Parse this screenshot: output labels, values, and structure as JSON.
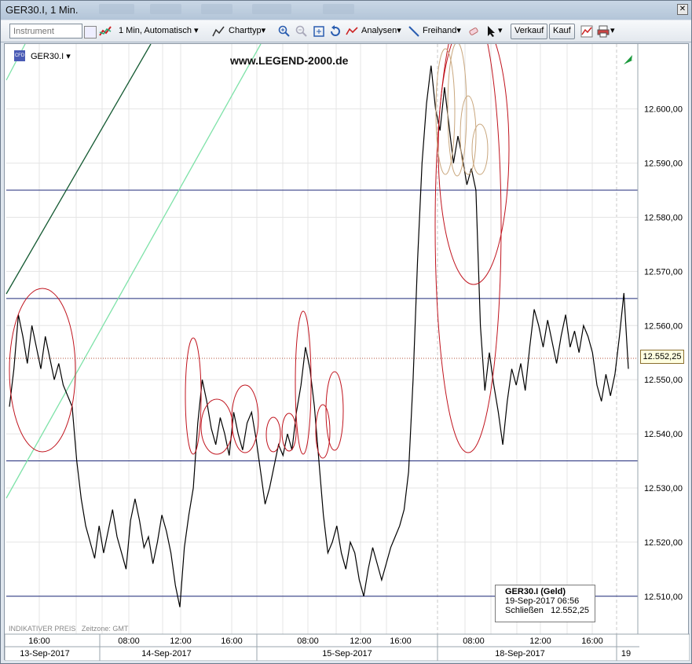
{
  "window": {
    "title": "GER30.I, 1 Min."
  },
  "toolbar": {
    "instrument_placeholder": "Instrument",
    "interval": "1 Min, Automatisch",
    "charttype": "Charttyp",
    "analysen": "Analysen",
    "freihand": "Freihand",
    "verkauf": "Verkauf",
    "kauf": "Kauf"
  },
  "chart": {
    "symbol": "GER30.I",
    "watermark": "www.LEGEND-2000.de",
    "indicative": "INDIKATIVER PREIS",
    "timezone": "Zeitzone: GMT",
    "current_price_label": "12.552,25",
    "colors": {
      "hline": "#1f2a7a",
      "price": "#000000",
      "circle": "#c0141e",
      "circle_light": "#c9a77e",
      "trend_dark": "#145a32",
      "trend_light": "#7ee2a8"
    }
  },
  "chart_data": {
    "type": "line",
    "ylim": [
      12503,
      12612
    ],
    "y_ticks": [
      "12.510,00",
      "12.520,00",
      "12.530,00",
      "12.540,00",
      "12.550,00",
      "12.560,00",
      "12.570,00",
      "12.580,00",
      "12.590,00",
      "12.600,00"
    ],
    "y_tick_values": [
      12510,
      12520,
      12530,
      12540,
      12550,
      12560,
      12570,
      12580,
      12590,
      12600
    ],
    "time_labels": [
      "16:00",
      "08:00",
      "12:00",
      "16:00",
      "08:00",
      "12:00",
      "16:00",
      "08:00",
      "12:00",
      "16:00"
    ],
    "date_labels": [
      "13-Sep-2017",
      "14-Sep-2017",
      "15-Sep-2017",
      "18-Sep-2017",
      "19"
    ],
    "hlines": [
      12585,
      12565,
      12535,
      12510
    ],
    "series": [
      {
        "values": [
          12545,
          12552,
          12562,
          12558,
          12553,
          12560,
          12556,
          12552,
          12558,
          12554,
          12550,
          12553,
          12549,
          12547,
          12545,
          12535,
          12528,
          12523,
          12520,
          12517,
          12523,
          12518,
          12522,
          12526,
          12521,
          12518,
          12515,
          12524,
          12528,
          12524,
          12519,
          12521,
          12516,
          12520,
          12525,
          12522,
          12518,
          12512,
          12508,
          12519,
          12525,
          12530,
          12542,
          12550,
          12546,
          12541,
          12538,
          12543,
          12540,
          12536,
          12544,
          12540,
          12537,
          12542,
          12544,
          12539,
          12533,
          12527,
          12530,
          12534,
          12538,
          12536,
          12540,
          12537,
          12544,
          12549,
          12556,
          12552,
          12545,
          12535,
          12525,
          12518,
          12520,
          12523,
          12518,
          12515,
          12520,
          12518,
          12513,
          12510,
          12515,
          12519,
          12516,
          12513,
          12516,
          12519,
          12521,
          12523,
          12526,
          12533,
          12550,
          12572,
          12590,
          12601,
          12608,
          12600,
          12596,
          12604,
          12597,
          12590,
          12595,
          12591,
          12586,
          12589,
          12585,
          12560,
          12548,
          12555,
          12549,
          12544,
          12538,
          12546,
          12552,
          12549,
          12553,
          12548,
          12556,
          12563,
          12560,
          12556,
          12561,
          12557,
          12553,
          12558,
          12562,
          12556,
          12559,
          12555,
          12560,
          12558,
          12555,
          12549,
          12546,
          12551,
          12547,
          12551,
          12558,
          12566,
          12552
        ]
      }
    ]
  }
}
